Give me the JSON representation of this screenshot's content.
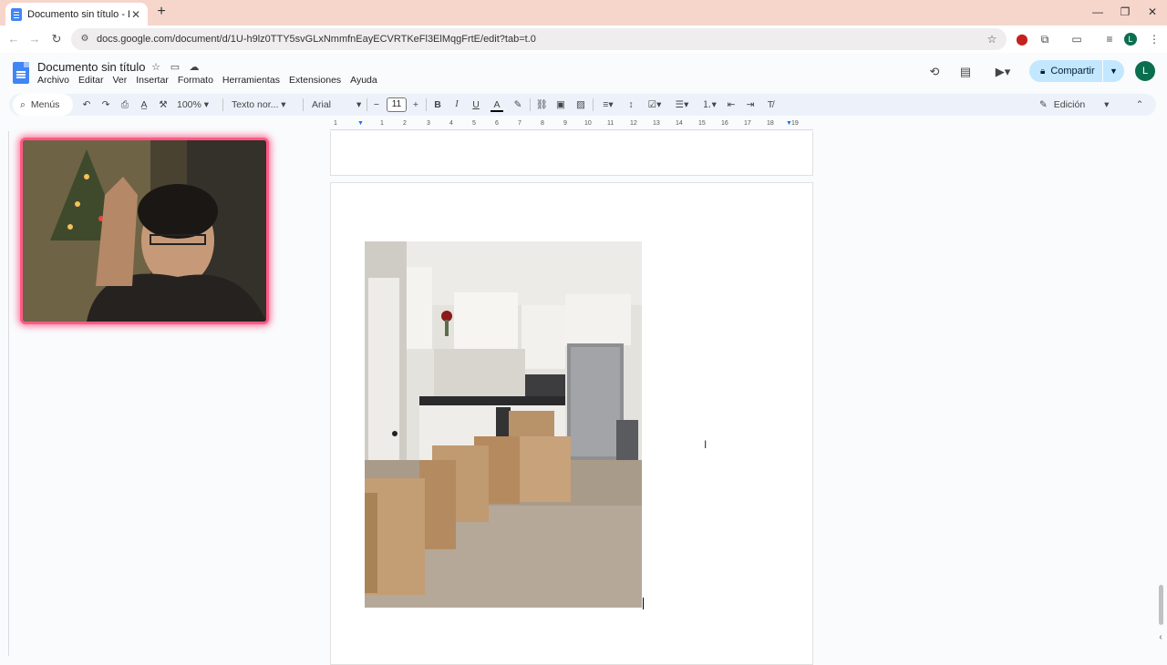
{
  "browser": {
    "tab_title": "Documento sin título - Docume",
    "tab_close": "✕",
    "new_tab": "+",
    "url": "docs.google.com/document/d/1U-h9lz0TTY5svGLxNmmfnEayECVRTKeFl3ElMqgFrtE/edit?tab=t.0",
    "win_min": "—",
    "win_restore": "❐",
    "win_close": "✕"
  },
  "doc": {
    "title": "Documento sin título",
    "menus": [
      "Archivo",
      "Editar",
      "Ver",
      "Insertar",
      "Formato",
      "Herramientas",
      "Extensiones",
      "Ayuda"
    ],
    "share_label": "Compartir",
    "avatar_letter": "L",
    "browser_avatar_letter": "L"
  },
  "toolbar": {
    "menus_label": "Menús",
    "zoom": "100%",
    "style": "Texto nor...",
    "font": "Arial",
    "font_size": "11",
    "mode": "Edición"
  },
  "ruler": {
    "numbers": [
      "1",
      "1",
      "2",
      "3",
      "4",
      "5",
      "6",
      "7",
      "8",
      "9",
      "10",
      "11",
      "12",
      "13",
      "14",
      "15",
      "16",
      "17",
      "18",
      "19"
    ]
  },
  "colors": {
    "tabstrip": "#f6d6cb",
    "share_bg": "#c2e7ff",
    "avatar": "#0b6e4f",
    "webcam_border": "#ff5a86",
    "docs_blue": "#4285f4"
  },
  "icons": [
    "docs-icon",
    "star-icon",
    "folder-icon",
    "cloud-icon",
    "history-icon",
    "comment-icon",
    "meet-icon",
    "lock-icon",
    "undo-icon",
    "redo-icon",
    "print-icon",
    "spellcheck-icon",
    "paint-format-icon",
    "bold-icon",
    "italic-icon",
    "underline-icon",
    "text-color-icon",
    "highlight-icon",
    "link-icon",
    "add-comment-icon",
    "insert-image-icon",
    "align-icon",
    "line-spacing-icon",
    "checklist-icon",
    "bullet-list-icon",
    "numbered-list-icon",
    "decrease-indent-icon",
    "increase-indent-icon",
    "clear-formatting-icon",
    "pencil-icon",
    "chevron-up-icon"
  ]
}
